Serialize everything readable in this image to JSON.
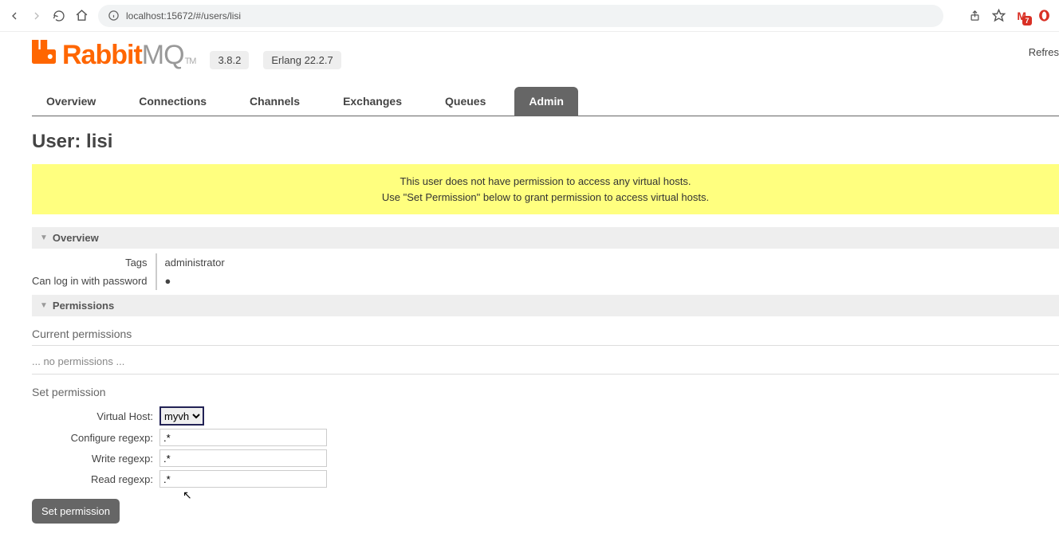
{
  "browser": {
    "url": "localhost:15672/#/users/lisi",
    "gmail_badge": "7"
  },
  "header": {
    "logo_rabbit": "Rabbit",
    "logo_mq": "MQ",
    "logo_tm": "TM",
    "version": "3.8.2",
    "erlang": "Erlang 22.2.7",
    "refresh": "Refres"
  },
  "tabs": {
    "overview": "Overview",
    "connections": "Connections",
    "channels": "Channels",
    "exchanges": "Exchanges",
    "queues": "Queues",
    "admin": "Admin"
  },
  "page_title": "User: lisi",
  "banner": {
    "line1": "This user does not have permission to access any virtual hosts.",
    "line2": "Use \"Set Permission\" below to grant permission to access virtual hosts."
  },
  "sections": {
    "overview": "Overview",
    "permissions": "Permissions"
  },
  "overview": {
    "tags_label": "Tags",
    "tags_value": "administrator",
    "login_label": "Can log in with password",
    "login_value": "●"
  },
  "permissions": {
    "current_heading": "Current permissions",
    "none_text": "... no permissions ...",
    "set_heading": "Set permission",
    "virtual_host_label": "Virtual Host:",
    "virtual_host_value": "myvh",
    "configure_label": "Configure regexp:",
    "configure_value": ".*",
    "write_label": "Write regexp:",
    "write_value": ".*",
    "read_label": "Read regexp:",
    "read_value": ".*",
    "button": "Set permission"
  }
}
